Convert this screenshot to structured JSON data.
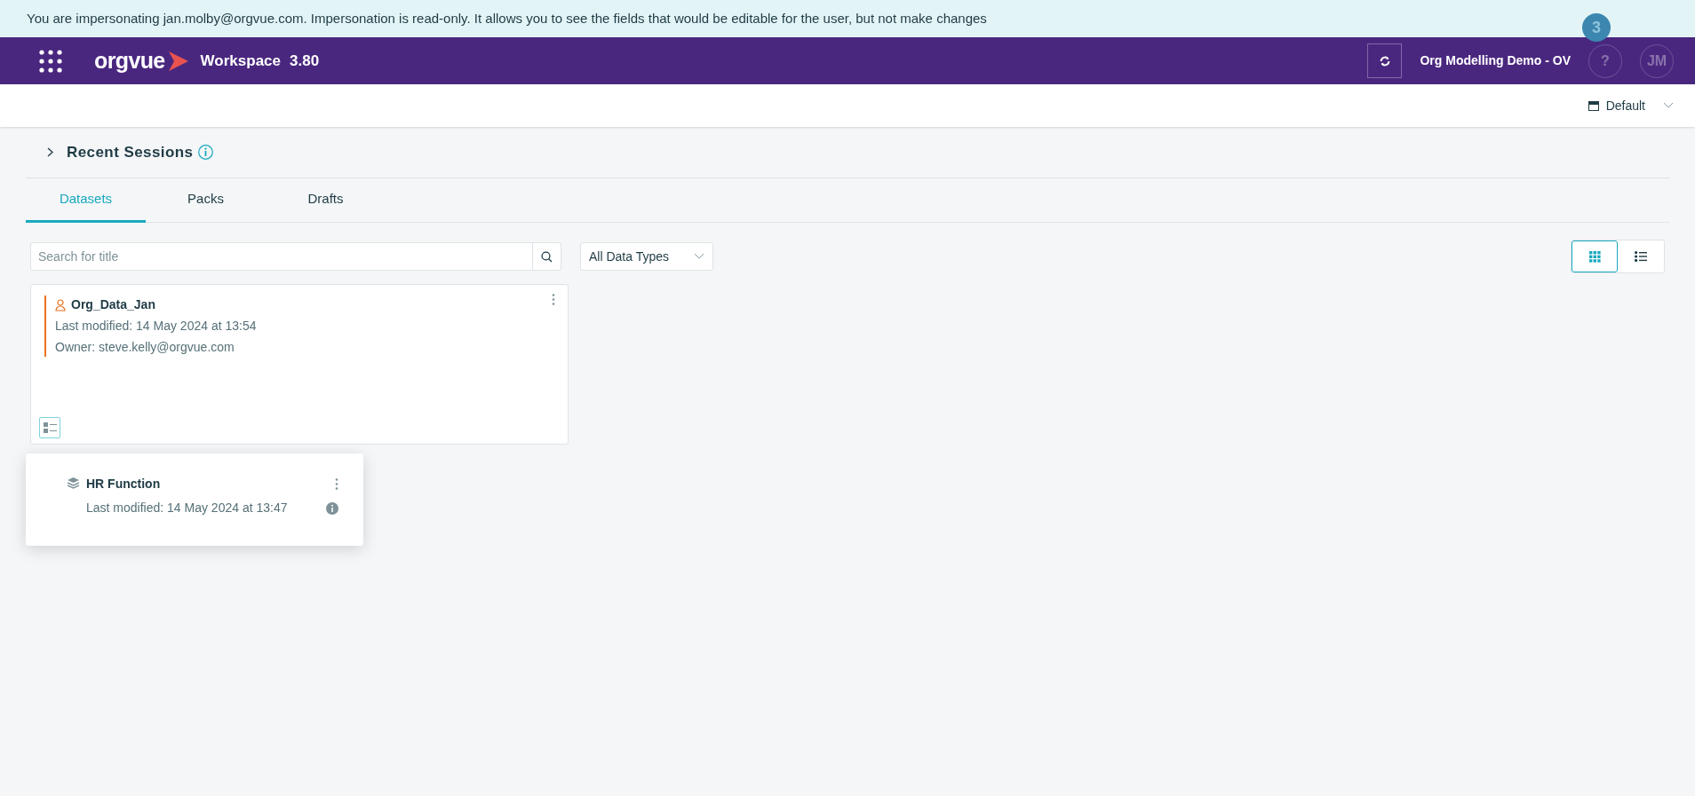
{
  "banner": {
    "text": "You are impersonating jan.molby@orgvue.com. Impersonation is read-only. It allows you to see the fields that would be editable for the user, but not make changes"
  },
  "header": {
    "logo": "orgvue",
    "app_name": "Workspace",
    "version": "3.80",
    "session": "Org Modelling Demo - OV",
    "notification_count": "3",
    "help": "?",
    "avatar": "JM"
  },
  "toolbar": {
    "layout": "Default"
  },
  "recent_sessions": {
    "title": "Recent Sessions",
    "expanded": false
  },
  "tabs": [
    {
      "label": "Datasets",
      "selected": true
    },
    {
      "label": "Packs",
      "selected": false
    },
    {
      "label": "Drafts",
      "selected": false
    }
  ],
  "search": {
    "placeholder": "Search for title"
  },
  "filter": {
    "value": "All Data Types"
  },
  "view_modes": [
    {
      "kind": "grid",
      "selected": true
    },
    {
      "kind": "list",
      "selected": false
    }
  ],
  "cards": [
    {
      "title": "Org_Data_Jan",
      "modified": "Last modified: 14 May 2024 at 13:54",
      "owner": "Owner: steve.kelly@orgvue.com"
    }
  ],
  "popup": {
    "items": [
      {
        "title": "HR Function",
        "modified": "Last modified: 14 May 2024 at 13:47"
      }
    ]
  }
}
